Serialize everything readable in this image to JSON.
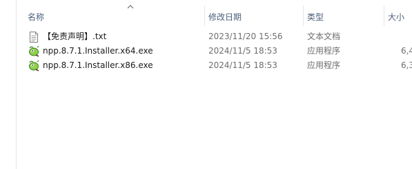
{
  "columns": {
    "name": "名称",
    "date_modified": "修改日期",
    "type": "类型",
    "size": "大小"
  },
  "sort": {
    "column": "name",
    "direction": "ascending",
    "indicator_icon": "chevron-up-icon"
  },
  "files": [
    {
      "name": "【免责声明】.txt",
      "date_modified": "2023/11/20 15:56",
      "type": "文本文档",
      "size": "",
      "icon": "text-document-icon"
    },
    {
      "name": "npp.8.7.1.Installer.x64.exe",
      "date_modified": "2024/11/5 18:53",
      "type": "应用程序",
      "size": "6,4",
      "icon": "notepad-plus-plus-icon"
    },
    {
      "name": "npp.8.7.1.Installer.x86.exe",
      "date_modified": "2024/11/5 18:53",
      "type": "应用程序",
      "size": "6,3",
      "icon": "notepad-plus-plus-icon"
    }
  ],
  "colors": {
    "header_text": "#4c607a",
    "secondary_text": "#6d6d6d",
    "primary_text": "#1a1a1a"
  }
}
